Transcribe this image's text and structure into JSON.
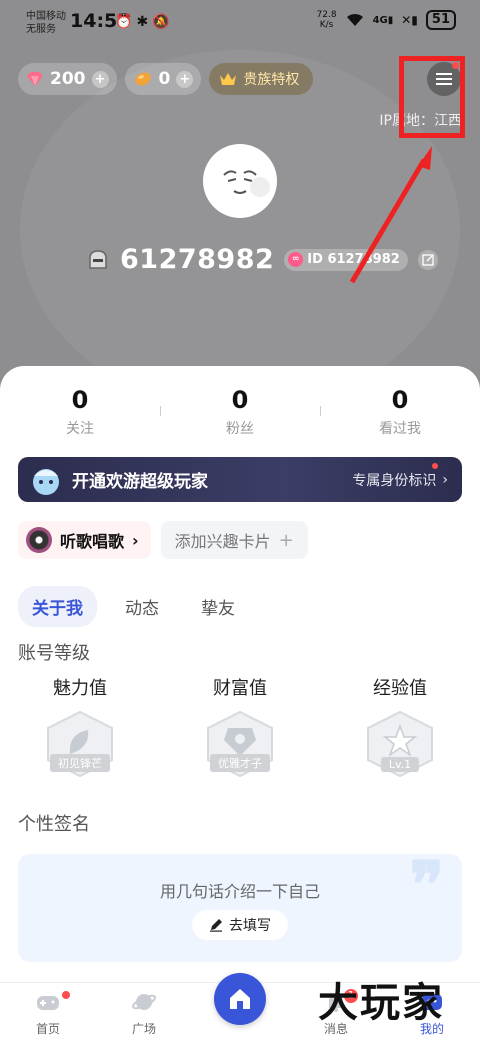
{
  "status_bar": {
    "carrier_line1": "中国移动",
    "carrier_line2": "无服务",
    "time": "14:57",
    "net_speed": "72.8",
    "net_unit": "K/s",
    "battery": "51"
  },
  "currency": {
    "gems": "200",
    "beans": "0",
    "vip_label": "贵族特权"
  },
  "ip_location": "IP属地：江西",
  "profile": {
    "username": "61278982",
    "id_label": "ID 61278982"
  },
  "stats": [
    {
      "value": "0",
      "label": "关注"
    },
    {
      "value": "0",
      "label": "粉丝"
    },
    {
      "value": "0",
      "label": "看过我"
    }
  ],
  "vip_banner": {
    "title": "开通欢游超级玩家",
    "right_text": "专属身份标识"
  },
  "tags": {
    "song": "听歌唱歌",
    "add_card": "添加兴趣卡片"
  },
  "tabs": [
    "关于我",
    "动态",
    "挚友"
  ],
  "account_level": {
    "title": "账号等级",
    "items": [
      {
        "name": "魅力值",
        "badge": "初见锋芒"
      },
      {
        "name": "财富值",
        "badge": "优雅才子"
      },
      {
        "name": "经验值",
        "badge": "Lv.1"
      }
    ]
  },
  "signature": {
    "title": "个性签名",
    "hint": "用几句话介绍一下自己",
    "button": "去填写"
  },
  "bottom_nav": {
    "home": "首页",
    "square": "广场",
    "messages": "消息",
    "messages_badge": "1",
    "mine": "我的"
  },
  "watermark": "大玩家",
  "colors": {
    "accent": "#3a56d8",
    "annotation": "#ee2222",
    "badge_red": "#ff4d4d"
  }
}
